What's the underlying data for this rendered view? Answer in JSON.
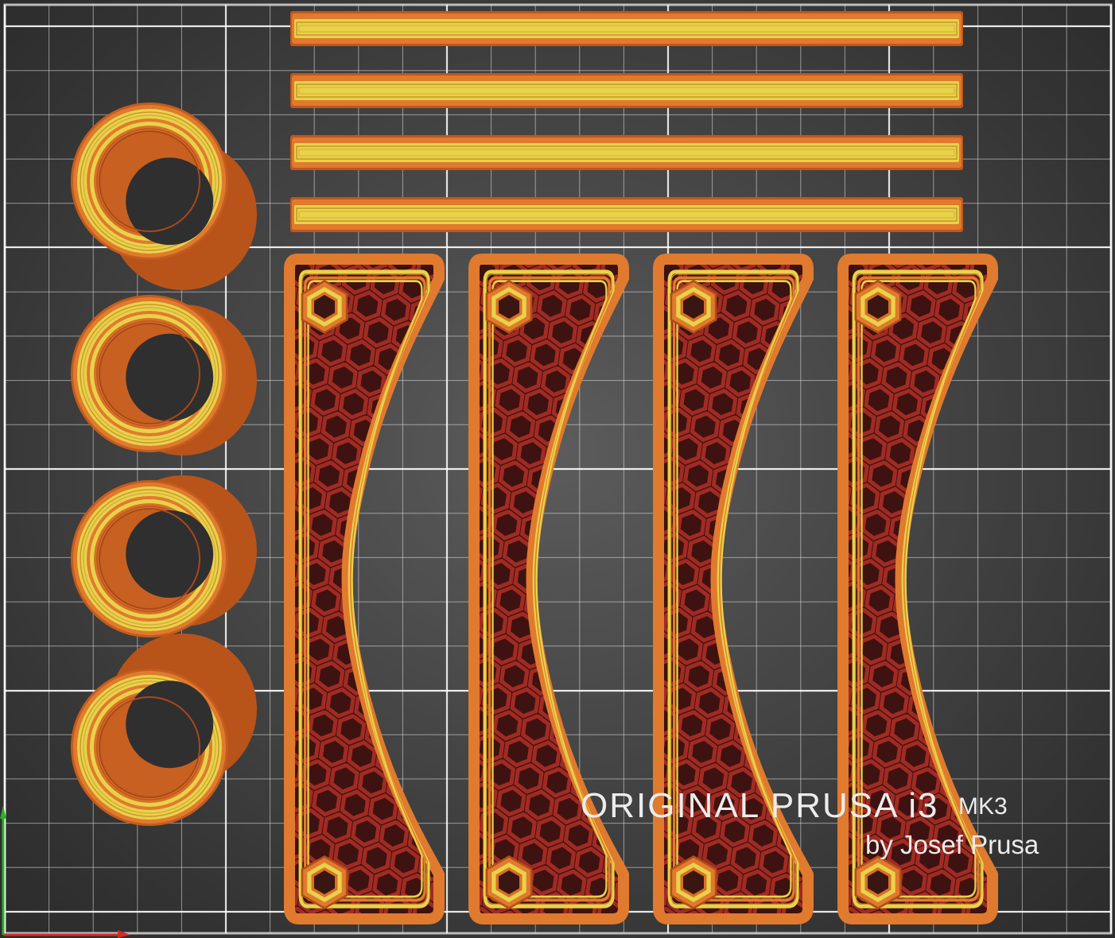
{
  "bed": {
    "brand_text": "ORIGINAL PRUSA i3",
    "model_text": "MK3",
    "author_text": "by Josef Prusa"
  },
  "colors": {
    "grid_line": "#ffffff",
    "bed_background": "#4a4a4a",
    "perimeter_outer": "#e07a2e",
    "perimeter_inner": "#e8d24a",
    "infill": "#9e2a22",
    "axis_x": "#d42a2a",
    "axis_y": "#2ab02a"
  },
  "objects": {
    "rods": [
      "rod",
      "rod",
      "rod",
      "rod"
    ],
    "bushings": [
      "bushing",
      "bushing",
      "bushing",
      "bushing"
    ],
    "arms": [
      "arm",
      "arm",
      "arm",
      "arm"
    ]
  },
  "icons": {
    "x_axis": "axis-x-arrow-icon",
    "y_axis": "axis-y-arrow-icon"
  }
}
